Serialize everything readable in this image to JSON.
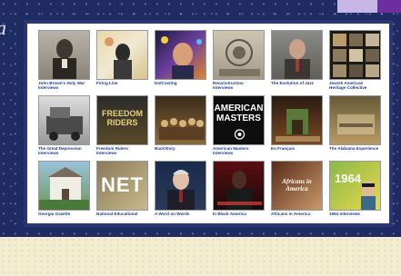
{
  "background_word": "a",
  "collections": [
    {
      "title": "John Brown's Holy War Interviews",
      "overlay": ""
    },
    {
      "title": "Firing Line",
      "overlay": ""
    },
    {
      "title": "DotCasting",
      "overlay": ""
    },
    {
      "title": "Reconstruction Interviews",
      "overlay": ""
    },
    {
      "title": "The Evolution of Jazz",
      "overlay": ""
    },
    {
      "title": "Jewish American Heritage Collective",
      "overlay": ""
    },
    {
      "title": "The Great Depression Interviews",
      "overlay": ""
    },
    {
      "title": "Freedom Riders Interviews",
      "overlay": "FREEDOM RIDERS"
    },
    {
      "title": "BackStory",
      "overlay": ""
    },
    {
      "title": "American Masters Interviews",
      "overlay": "AMERICAN MASTERS"
    },
    {
      "title": "En Français",
      "overlay": ""
    },
    {
      "title": "The Alabama Experience",
      "overlay": ""
    },
    {
      "title": "Georgia Gazette",
      "overlay": ""
    },
    {
      "title": "National Educational",
      "overlay": "NET"
    },
    {
      "title": "A Word on Words",
      "overlay": ""
    },
    {
      "title": "In Black America",
      "overlay": ""
    },
    {
      "title": "Africans in America",
      "overlay": "Africans in America"
    },
    {
      "title": "1964 Interviews",
      "overlay": "1964"
    }
  ]
}
